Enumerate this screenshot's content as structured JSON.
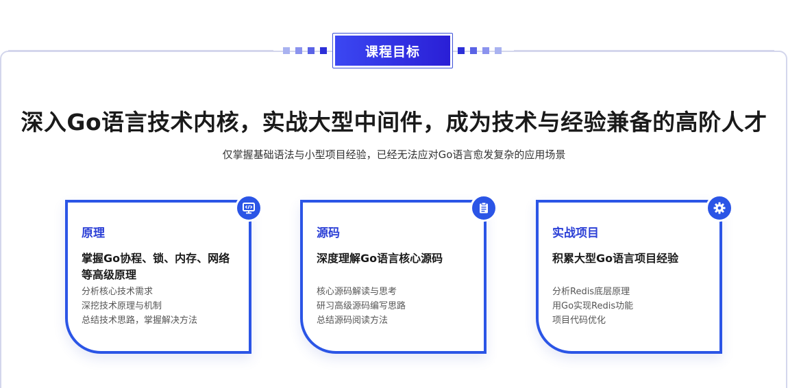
{
  "section": {
    "badge_label": "课程目标",
    "headline": "深入Go语言技术内核，实战大型中间件，成为技术与经验兼备的高阶人才",
    "subline": "仅掌握基础语法与小型项目经验，已经无法应对Go语言愈发复杂的应用场景"
  },
  "cards": [
    {
      "category": "原理",
      "title": "掌握Go协程、锁、内存、网络等高级原理",
      "icon": "code-monitor-icon",
      "items": [
        "分析核心技术需求",
        "深挖技术原理与机制",
        "总结技术思路，掌握解决方法"
      ]
    },
    {
      "category": "源码",
      "title": "深度理解Go语言核心源码",
      "icon": "clipboard-icon",
      "items": [
        "核心源码解读与思考",
        "研习高级源码编写思路",
        "总结源码阅读方法"
      ]
    },
    {
      "category": "实战项目",
      "title": "积累大型Go语言项目经验",
      "icon": "gear-icon",
      "items": [
        "分析Redis底层原理",
        "用Go实现Redis功能",
        "项目代码优化"
      ]
    }
  ],
  "colors": {
    "accent": "#2b55e6",
    "badge_gradient_start": "#3b47f2",
    "badge_gradient_end": "#2a1fd6",
    "category_text": "#2b3fd6",
    "panel_border": "#d3d6ec",
    "dots_left": [
      "#a9b2f0",
      "#8b93ee",
      "#5a63e6",
      "#2c2fd8"
    ],
    "dots_right": [
      "#2c2fd8",
      "#5a63e6",
      "#8b93ee",
      "#a9b2f0"
    ]
  }
}
